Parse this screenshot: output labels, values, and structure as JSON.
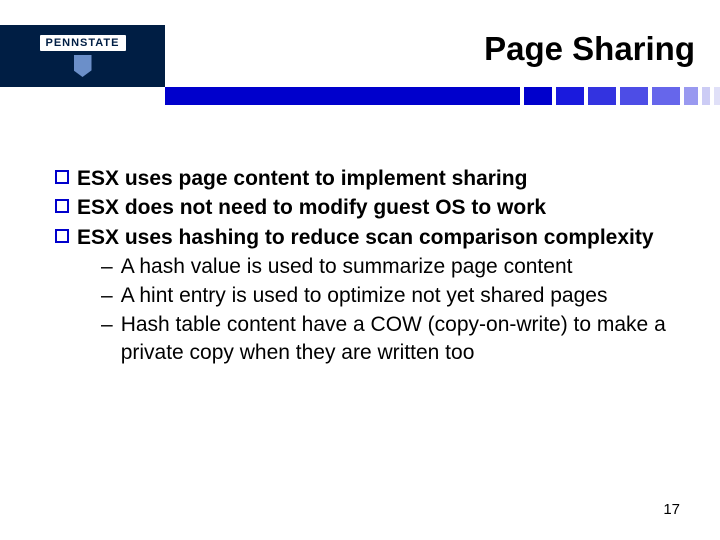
{
  "logo": {
    "text": "PENNSTATE"
  },
  "title": "Page Sharing",
  "bullets": [
    {
      "text": "ESX uses page content to implement sharing"
    },
    {
      "text": "ESX does not need to modify guest OS to work"
    },
    {
      "text": "ESX uses hashing to reduce scan comparison complexity"
    }
  ],
  "sub_bullets": [
    {
      "text": "A hash value is used to summarize page content"
    },
    {
      "text": "A hint entry is used to optimize not yet shared pages"
    },
    {
      "text": "Hash table content have a COW (copy-on-write) to make a private copy when they are written too"
    }
  ],
  "page_number": "17"
}
